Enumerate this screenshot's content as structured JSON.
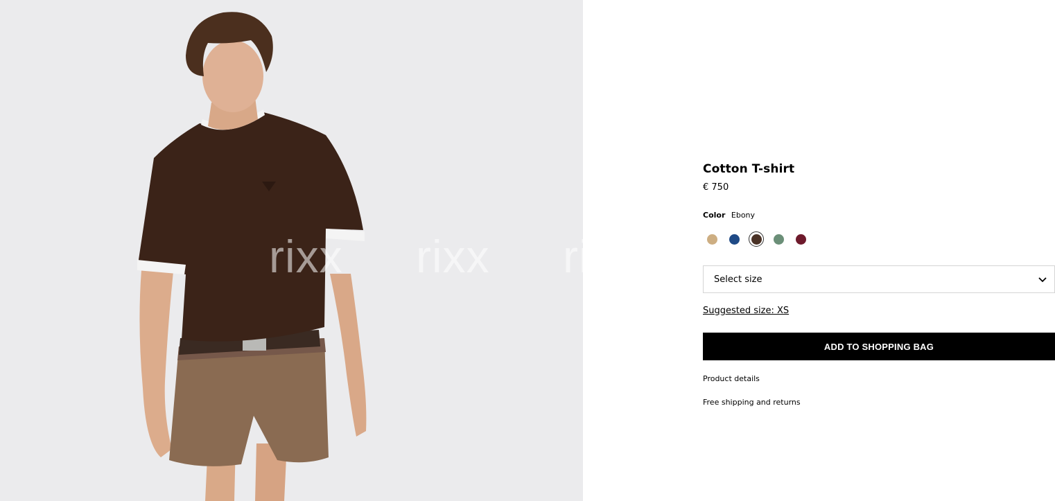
{
  "product": {
    "title": "Cotton T-shirt",
    "price": "€ 750",
    "color_label": "Color",
    "color_value": "Ebony",
    "colors": [
      {
        "name": "Beige",
        "hex": "#cdae82",
        "selected": false
      },
      {
        "name": "Navy",
        "hex": "#1f4a86",
        "selected": false
      },
      {
        "name": "Ebony",
        "hex": "#4a3226",
        "selected": true
      },
      {
        "name": "Green",
        "hex": "#6b8f78",
        "selected": false
      },
      {
        "name": "Burgundy",
        "hex": "#6e1a2c",
        "selected": false
      }
    ]
  },
  "size_select": {
    "label": "Select size",
    "icon": "chevron-down-icon"
  },
  "suggested_size": "Suggested size: XS",
  "add_button": "ADD TO SHOPPING BAG",
  "links": {
    "details": "Product details",
    "shipping": "Free shipping and returns"
  },
  "watermarks": [
    "rixx",
    "rixx",
    "rixx"
  ]
}
